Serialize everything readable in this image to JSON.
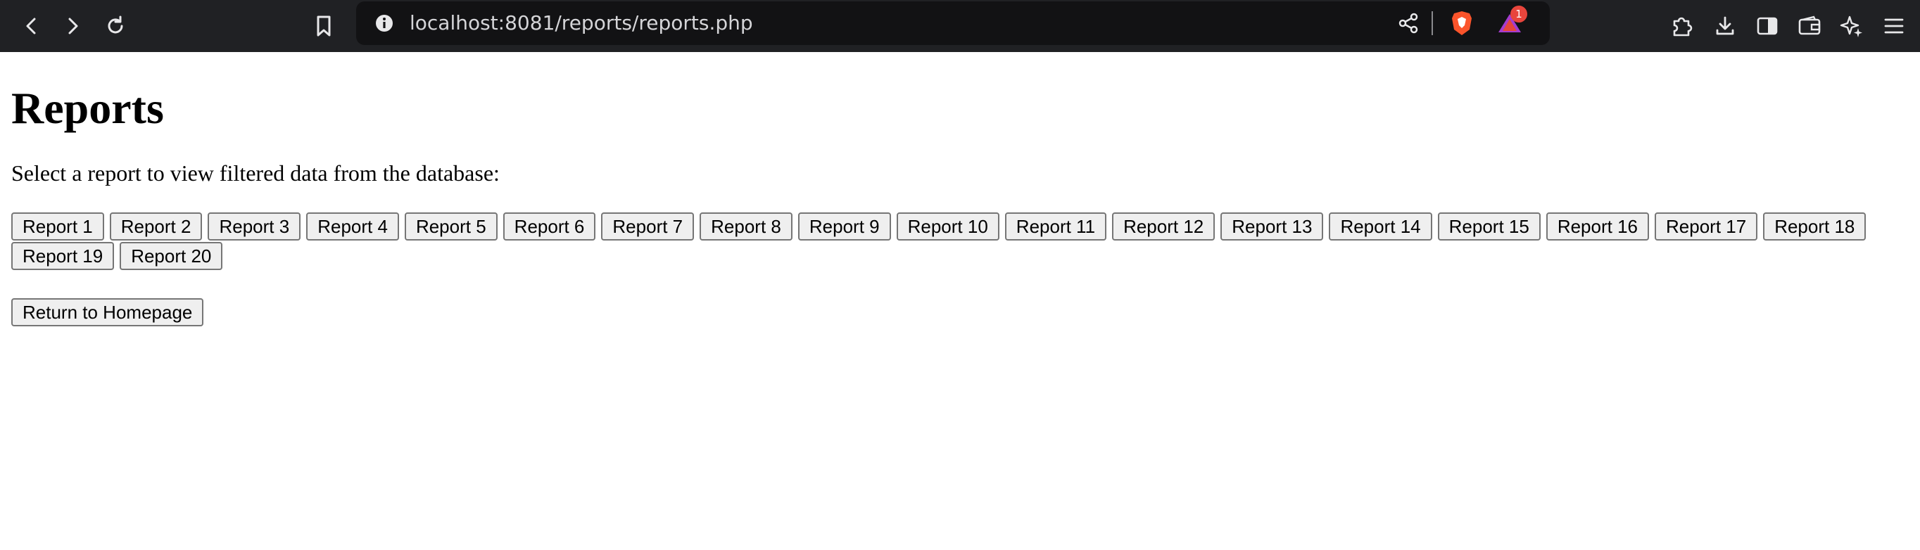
{
  "browser": {
    "url": "localhost:8081/reports/reports.php",
    "notification_count": "1"
  },
  "page": {
    "title": "Reports",
    "intro": "Select a report to view filtered data from the database:",
    "reports": [
      "Report 1",
      "Report 2",
      "Report 3",
      "Report 4",
      "Report 5",
      "Report 6",
      "Report 7",
      "Report 8",
      "Report 9",
      "Report 10",
      "Report 11",
      "Report 12",
      "Report 13",
      "Report 14",
      "Report 15",
      "Report 16",
      "Report 17",
      "Report 18",
      "Report 19",
      "Report 20"
    ],
    "home_button": "Return to Homepage"
  },
  "colors": {
    "toolbar_bg": "#202124",
    "urlbar_bg": "#121214",
    "button_bg": "#efefef",
    "button_border": "#767676",
    "brave_orange": "#fb542b",
    "badge_red": "#e8453c"
  },
  "icons": [
    "back-icon",
    "forward-icon",
    "reload-icon",
    "bookmark-icon",
    "site-info-icon",
    "share-icon",
    "brave-shields-icon",
    "brave-rewards-icon",
    "extensions-icon",
    "downloads-icon",
    "sidebar-icon",
    "wallet-icon",
    "leo-ai-icon",
    "menu-icon"
  ]
}
